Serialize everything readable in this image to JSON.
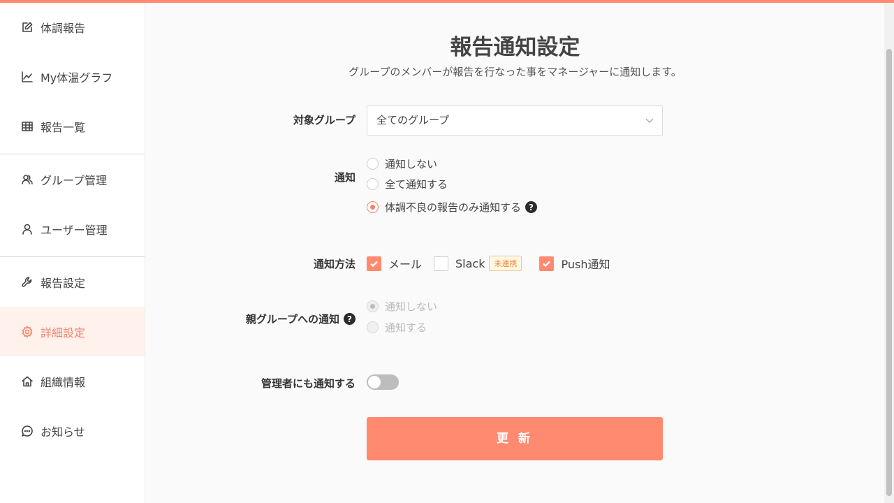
{
  "sidebar": {
    "items": [
      {
        "label": "体調報告",
        "icon": "edit-icon"
      },
      {
        "label": "My体温グラフ",
        "icon": "line-chart-icon"
      },
      {
        "label": "報告一覧",
        "icon": "table-icon"
      },
      {
        "label": "グループ管理",
        "icon": "users-icon"
      },
      {
        "label": "ユーザー管理",
        "icon": "user-icon"
      },
      {
        "label": "報告設定",
        "icon": "wrench-icon"
      },
      {
        "label": "詳細設定",
        "icon": "gear-icon"
      },
      {
        "label": "組織情報",
        "icon": "home-icon"
      },
      {
        "label": "お知らせ",
        "icon": "message-icon"
      }
    ],
    "active_index": 6
  },
  "page": {
    "title": "報告通知設定",
    "subtitle": "グループのメンバーが報告を行なった事をマネージャーに通知します。"
  },
  "form": {
    "target_group": {
      "label": "対象グループ",
      "value": "全てのグループ"
    },
    "notification": {
      "label": "通知",
      "options": [
        "通知しない",
        "全て通知する",
        "体調不良の報告のみ通知する"
      ],
      "selected": 2
    },
    "method": {
      "label": "通知方法",
      "mail": {
        "label": "メール",
        "checked": true
      },
      "slack": {
        "label": "Slack",
        "checked": false,
        "badge": "未連携"
      },
      "push": {
        "label": "Push通知",
        "checked": true
      }
    },
    "parent_group": {
      "label": "親グループへの通知",
      "options": [
        "通知しない",
        "通知する"
      ],
      "selected": 0,
      "disabled": true
    },
    "admin_notify": {
      "label": "管理者にも通知する",
      "enabled": false
    },
    "submit_label": "更 新"
  },
  "colors": {
    "accent": "#ff8a70",
    "accent_text": "#f2846c",
    "active_bg": "#fff1ec"
  }
}
